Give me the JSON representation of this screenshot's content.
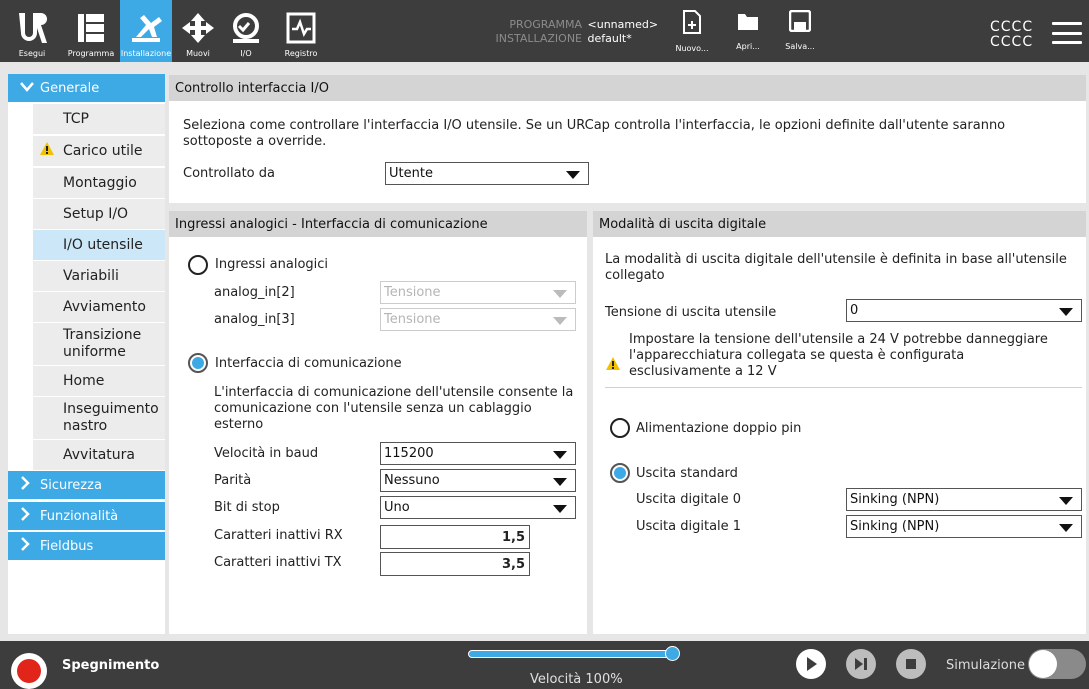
{
  "topnav": {
    "items": [
      {
        "label": "Esegui",
        "icon": "ur-logo-icon"
      },
      {
        "label": "Programma",
        "icon": "program-icon"
      },
      {
        "label": "Installazione",
        "icon": "installation-icon",
        "active": true
      },
      {
        "label": "Muovi",
        "icon": "move-icon"
      },
      {
        "label": "I/O",
        "icon": "io-icon"
      },
      {
        "label": "Registro",
        "icon": "log-icon"
      }
    ]
  },
  "program": {
    "program_key": "PROGRAMMA",
    "program_value": "<unnamed>",
    "installation_key": "INSTALLAZIONE",
    "installation_value": "default*"
  },
  "file_actions": {
    "new_label": "Nuovo...",
    "open_label": "Apri...",
    "save_label": "Salva..."
  },
  "user": {
    "line1": "CCCC",
    "line2": "CCCC"
  },
  "sidebar": {
    "categories": {
      "generale": "Generale",
      "sicurezza": "Sicurezza",
      "funzionalita": "Funzionalità",
      "fieldbus": "Fieldbus"
    },
    "items": [
      {
        "label": "TCP"
      },
      {
        "label": "Carico utile",
        "warning": true
      },
      {
        "label": "Montaggio"
      },
      {
        "label": "Setup I/O"
      },
      {
        "label": "I/O utensile",
        "active": true
      },
      {
        "label": "Variabili"
      },
      {
        "label": "Avviamento"
      },
      {
        "label": "Transizione uniforme"
      },
      {
        "label": "Home"
      },
      {
        "label": "Inseguimento nastro"
      },
      {
        "label": "Avvitatura"
      }
    ]
  },
  "control": {
    "header": "Controllo interfaccia I/O",
    "description": "Seleziona come controllare l'interfaccia I/O utensile. Se un URCap controlla l'interfaccia, le opzioni definite dall'utente saranno sottoposte a override.",
    "controlled_by_label": "Controllato da",
    "controlled_by_value": "Utente"
  },
  "analog": {
    "header": "Ingressi analogici - Interfaccia di comunicazione",
    "analog_inputs_radio": "Ingressi analogici",
    "analog_in2_label": "analog_in[2]",
    "analog_in2_value": "Tensione",
    "analog_in3_label": "analog_in[3]",
    "analog_in3_value": "Tensione",
    "comm_interface_radio": "Interfaccia di comunicazione",
    "comm_description": "L'interfaccia di comunicazione dell'utensile consente la comunicazione con l'utensile senza un cablaggio esterno",
    "baud_label": "Velocità in baud",
    "baud_value": "115200",
    "parity_label": "Parità",
    "parity_value": "Nessuno",
    "stopbit_label": "Bit di stop",
    "stopbit_value": "Uno",
    "rx_idle_label": "Caratteri inattivi RX",
    "rx_idle_value": "1,5",
    "tx_idle_label": "Caratteri inattivi TX",
    "tx_idle_value": "3,5"
  },
  "digital": {
    "header": "Modalità di uscita digitale",
    "description": "La modalità di uscita digitale dell'utensile è definita in base all'utensile collegato",
    "voltage_label": "Tensione di uscita utensile",
    "voltage_value": "0",
    "warning_text": "Impostare la tensione dell'utensile a 24 V potrebbe danneggiare l'apparecchiatura collegata se questa è configurata esclusivamente a 12 V",
    "dual_pin_radio": "Alimentazione doppio pin",
    "standard_radio": "Uscita standard",
    "do0_label": "Uscita digitale 0",
    "do0_value": "Sinking (NPN)",
    "do1_label": "Uscita digitale 1",
    "do1_value": "Sinking (NPN)"
  },
  "bottom": {
    "power_label": "Spegnimento",
    "speed_label": "Velocità 100%",
    "speed_fraction": 1.0,
    "sim_label": "Simulazione"
  },
  "colors": {
    "accent": "#3da9e5",
    "bar": "#3d3d3d",
    "power": "#e1251b",
    "warning": "#f2c200"
  }
}
